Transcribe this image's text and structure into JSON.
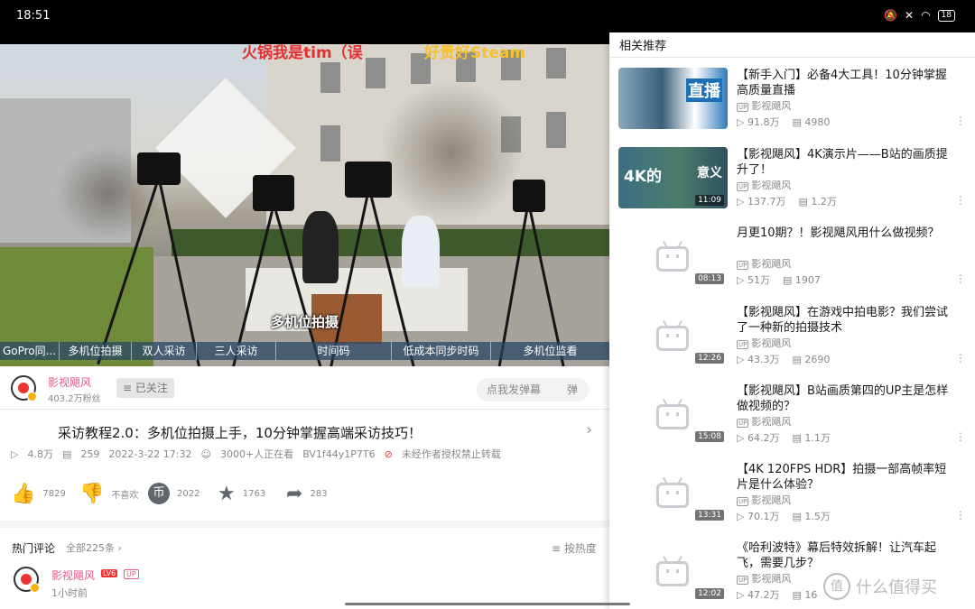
{
  "status": {
    "time": "18:51",
    "battery": "18"
  },
  "video": {
    "danmaku": [
      "火锅我是tim（误",
      "好贵好Steam"
    ],
    "subtitle": "多机位拍摄",
    "chapters": [
      "GoPro同...",
      "多机位拍摄",
      "双人采访",
      "三人采访",
      "时间码",
      "低成本同步时码",
      "多机位监看"
    ]
  },
  "uploader": {
    "name": "影视飓风",
    "fans": "403.2万粉丝",
    "follow_label": "已关注"
  },
  "danmaku_input": {
    "placeholder": "点我发弹幕",
    "toggle": "弹"
  },
  "video_info": {
    "title": "采访教程2.0：多机位拍摄上手，10分钟掌握高端采访技巧！",
    "views": "4.8万",
    "danmaku_count": "259",
    "date": "2022-3-22 17:32",
    "watching": "3000+人正在看",
    "bvid": "BV1f44y1P7T6",
    "copyright": "未经作者授权禁止转载"
  },
  "actions": {
    "like": "7829",
    "dislike": "不喜欢",
    "coin": "2022",
    "favorite": "1763",
    "share": "283"
  },
  "comments": {
    "header": "热门评论",
    "total": "全部225条",
    "sort": "按热度",
    "first": {
      "user": "影视飓风",
      "level": "LV6",
      "tag": "UP",
      "time": "1小时前"
    }
  },
  "panel": {
    "title": "相关推荐",
    "items": [
      {
        "title": "【新手入门】必备4大工具！10分钟掌握高质量直播",
        "up": "影视飓风",
        "views": "91.8万",
        "comments": "4980",
        "duration": "",
        "thumb_text": "直播"
      },
      {
        "title": "【影视飓风】4K演示片——B站的画质提升了！",
        "up": "影视飓风",
        "views": "137.7万",
        "comments": "1.2万",
        "duration": "11:09",
        "thumb_text": "4K的",
        "thumb_text2": "意义"
      },
      {
        "title": "月更10期？！影视飓风用什么做视频？",
        "up": "影视飓风",
        "views": "51万",
        "comments": "1907",
        "duration": "08:13"
      },
      {
        "title": "【影视飓风】在游戏中拍电影？我们尝试了一种新的拍摄技术",
        "up": "影视飓风",
        "views": "43.3万",
        "comments": "2690",
        "duration": "12:26"
      },
      {
        "title": "【影视飓风】B站画质第四的UP主是怎样做视频的？",
        "up": "影视飓风",
        "views": "64.2万",
        "comments": "1.1万",
        "duration": "15:08"
      },
      {
        "title": "【4K 120FPS HDR】拍摄一部高帧率短片是什么体验？",
        "up": "影视飓风",
        "views": "70.1万",
        "comments": "1.5万",
        "duration": "13:31"
      },
      {
        "title": "《哈利波特》幕后特效拆解！让汽车起飞，需要几步？",
        "up": "影视飓风",
        "views": "47.2万",
        "comments": "16",
        "duration": "12:02"
      }
    ]
  },
  "watermark": {
    "text": "什么值得买",
    "mark": "值"
  }
}
